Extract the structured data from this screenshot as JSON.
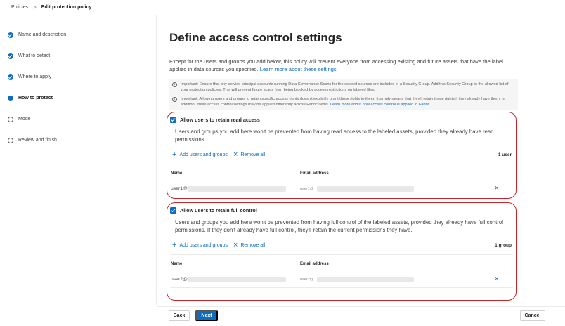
{
  "breadcrumb": {
    "parent": "Policies",
    "separator": ">",
    "current": "Edit protection policy"
  },
  "stepper": {
    "steps": [
      {
        "label": "Name and description",
        "state": "done"
      },
      {
        "label": "What to detect",
        "state": "done"
      },
      {
        "label": "Where to apply",
        "state": "done"
      },
      {
        "label": "How to protect",
        "state": "current"
      },
      {
        "label": "Mode",
        "state": "todo"
      },
      {
        "label": "Review and finish",
        "state": "todo"
      }
    ]
  },
  "main": {
    "title": "Define access control settings",
    "description": "Except for the users and groups you add below, this policy will prevent everyone from accessing existing and future assets that have the label applied in data sources you specified.",
    "learn_more": "Learn more about these settings",
    "notices": [
      {
        "text": "Important: Ensure that any service principal accounts running Data Governance Scans for the scoped sources are included in a Security Group. Add this Security Group to the allowed list of your protection policies. This will prevent future scans from being blocked by access restrictions on labeled files.",
        "link": ""
      },
      {
        "text": "Important: Allowing users and groups to retain specific access rights doesn't explicitly grant those rights to them. It simply means that they'll retain those rights if they already have them. In addition, these access control settings may be applied differently across Fabric items.",
        "link": "Learn more about how access control is applied in Fabric"
      }
    ]
  },
  "read_section": {
    "checkbox_label": "Allow users to retain read access",
    "checked": true,
    "description": "Users and groups you add here won't be prevented from having read access to the labeled assets, provided they already have read permissions.",
    "add_label": "Add users and groups",
    "remove_label": "Remove all",
    "count": "1 user",
    "col_name": "Name",
    "col_email": "Email address",
    "row": {
      "name": "user1@",
      "email": "user1@"
    }
  },
  "full_section": {
    "checkbox_label": "Allow users to retain full control",
    "checked": true,
    "description": "Users and groups you add here won't be prevented from having full control of the labeled assets, provided they already have full control permissions. If they don't already have full control, they'll retain the current permissions they have.",
    "add_label": "Add users and groups",
    "remove_label": "Remove all",
    "count": "1 group",
    "col_name": "Name",
    "col_email": "Email address",
    "row": {
      "name": "user2@",
      "email": "user2@"
    }
  },
  "footer": {
    "back_label": "Back",
    "next_label": "Next",
    "cancel_label": "Cancel"
  },
  "colors": {
    "accent": "#0f6cbd",
    "highlight_outline": "#c4262e"
  },
  "icons": {
    "step_done": "checkmark-circle-icon",
    "info": "info-icon",
    "add": "plus-icon",
    "remove": "dismiss-icon"
  }
}
